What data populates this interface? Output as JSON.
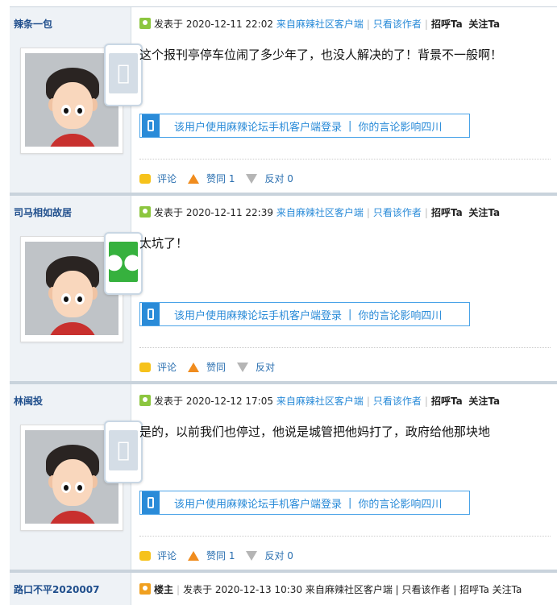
{
  "posts": [
    {
      "user": "辣条一包",
      "device": "apple",
      "meta_prefix": "发表于",
      "time": "2020-12-11 22:02",
      "source": "来自麻辣社区客户端",
      "only_author": "只看该作者",
      "greet": "招呼Ta",
      "follow": "关注Ta",
      "content": "这个报刊亭停车位闹了多少年了，也没人解决的了！背景不一般啊！",
      "app_text": "该用户使用麻辣论坛手机客户端登录",
      "app_divider": "|",
      "app_text2": "你的言论影响四川",
      "comment": "评论",
      "like": "赞同 1",
      "dislike": "反对 0"
    },
    {
      "user": "司马相如故居",
      "device": "wechat",
      "meta_prefix": "发表于",
      "time": "2020-12-11 22:39",
      "source": "来自麻辣社区客户端",
      "only_author": "只看该作者",
      "greet": "招呼Ta",
      "follow": "关注Ta",
      "content": "太坑了！",
      "app_text": "该用户使用麻辣论坛手机客户端登录",
      "app_divider": "|",
      "app_text2": "你的言论影响四川",
      "comment": "评论",
      "like": "赞同",
      "dislike": "反对"
    },
    {
      "user": "林闽投",
      "device": "apple",
      "meta_prefix": "发表于",
      "time": "2020-12-12 17:05",
      "source": "来自麻辣社区客户端",
      "only_author": "只看该作者",
      "greet": "招呼Ta",
      "follow": "关注Ta",
      "content": "是的，以前我们也停过，他说是城管把他妈打了，政府给他那块地",
      "app_text": "该用户使用麻辣论坛手机客户端登录",
      "app_divider": "|",
      "app_text2": "你的言论影响四川",
      "comment": "评论",
      "like": "赞同 1",
      "dislike": "反对 0"
    }
  ],
  "partial": {
    "user": "路口不平2020007",
    "floor": "楼主",
    "meta": "发表于 2020-12-13 10:30 来自麻辣社区客户端 | 只看该作者 | 招呼Ta 关注Ta"
  },
  "colors": {
    "link": "#2a8bd8",
    "user": "#1f4e8c",
    "sidebar": "#eef2f6",
    "wechat": "#36b13e"
  },
  "icons": {
    "apple": "apple-icon",
    "wechat": "wechat-icon",
    "phone": "phone-icon",
    "comment": "comment-icon",
    "up": "thumb-up-icon",
    "down": "thumb-down-icon"
  }
}
